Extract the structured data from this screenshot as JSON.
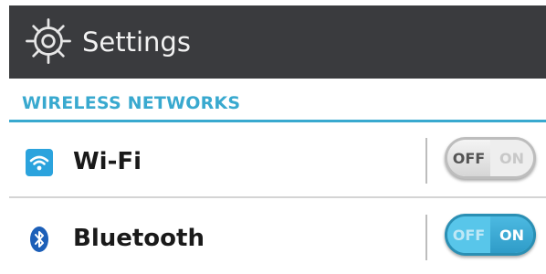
{
  "app_bar": {
    "icon": "settings-gear-icon",
    "title": "Settings",
    "background": "#3a3b3e"
  },
  "section": {
    "title": "WIRELESS NETWORKS",
    "accent": "#39a9cf"
  },
  "rows": [
    {
      "icon": "wifi-icon",
      "label": "Wi-Fi",
      "toggle": {
        "off_label": "OFF",
        "on_label": "ON",
        "state": "off"
      }
    },
    {
      "icon": "bluetooth-icon",
      "label": "Bluetooth",
      "toggle": {
        "off_label": "OFF",
        "on_label": "ON",
        "state": "on"
      }
    }
  ]
}
